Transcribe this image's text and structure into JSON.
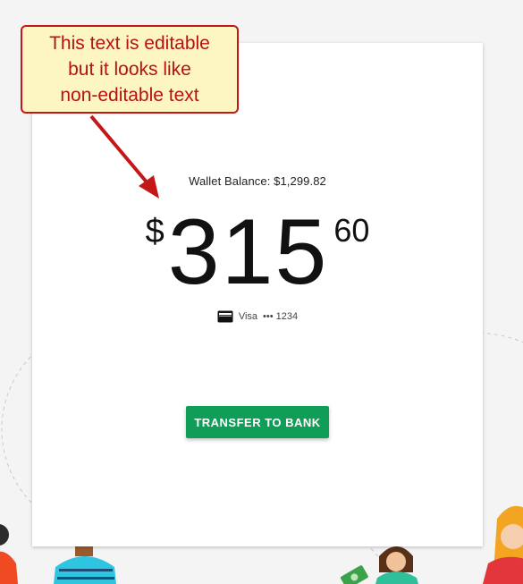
{
  "annotation": {
    "lines": [
      "This text is editable",
      "but it looks like",
      "non-editable text"
    ],
    "accent": "#c41818",
    "fill": "#fdf6c3"
  },
  "wallet": {
    "balance_label": "Wallet Balance: $1,299.82"
  },
  "transfer": {
    "currency_symbol": "$",
    "dollars": "315",
    "cents": "60"
  },
  "payment_method": {
    "icon": "credit-card-icon",
    "brand": "Visa",
    "masked": "••• 1234"
  },
  "actions": {
    "transfer_label": "TRANSFER TO BANK",
    "button_color": "#0f9d58"
  },
  "decorations": {
    "illustrations": [
      "person-figure-icon",
      "money-bill-icon"
    ]
  }
}
